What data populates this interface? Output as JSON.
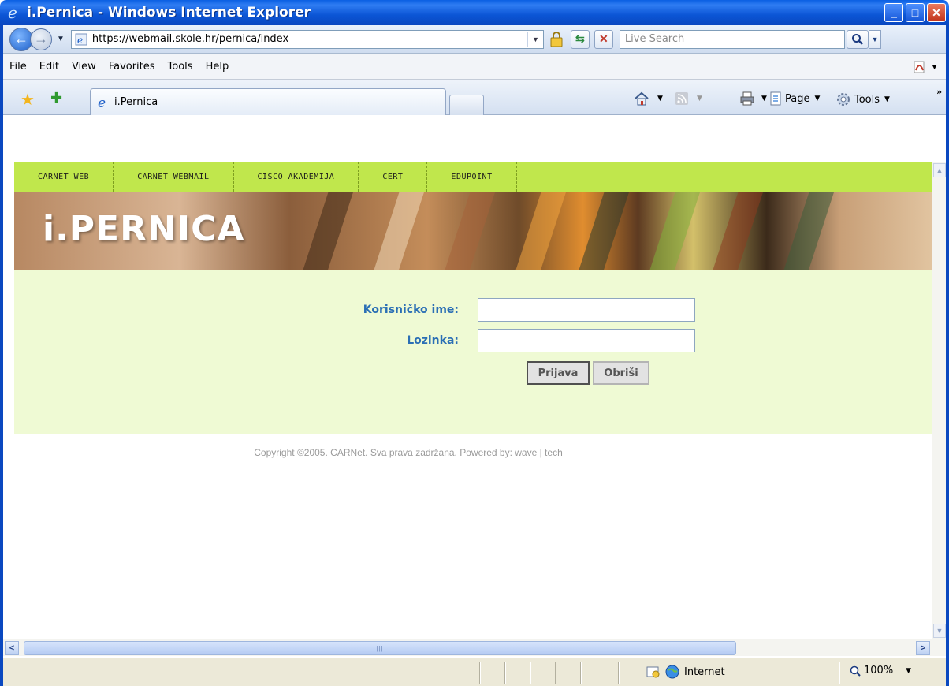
{
  "window": {
    "title": "i.Pernica - Windows Internet Explorer"
  },
  "addressbar": {
    "url": "https://webmail.skole.hr/pernica/index",
    "search_placeholder": "Live Search"
  },
  "menubar": {
    "items": [
      "File",
      "Edit",
      "View",
      "Favorites",
      "Tools",
      "Help"
    ]
  },
  "tabs": {
    "active_label": "i.Pernica"
  },
  "commandbar": {
    "page_label": "Page",
    "tools_label": "Tools"
  },
  "site": {
    "nav": [
      "CARNET WEB",
      "CARNET WEBMAIL",
      "CISCO AKADEMIJA",
      "CERT",
      "EDUPOINT"
    ],
    "banner_title": "i.PERNICA",
    "login": {
      "username_label": "Korisničko ime:",
      "password_label": "Lozinka:",
      "submit_label": "Prijava",
      "reset_label": "Obriši"
    },
    "copyright": "Copyright ©2005. CARNet. Sva prava zadržana. Powered by: wave | tech"
  },
  "statusbar": {
    "zone": "Internet",
    "zoom": "100%"
  },
  "colors": {
    "nav_green": "#c0e74c",
    "panel_green": "#effad4",
    "label_blue": "#2b6fb5"
  }
}
